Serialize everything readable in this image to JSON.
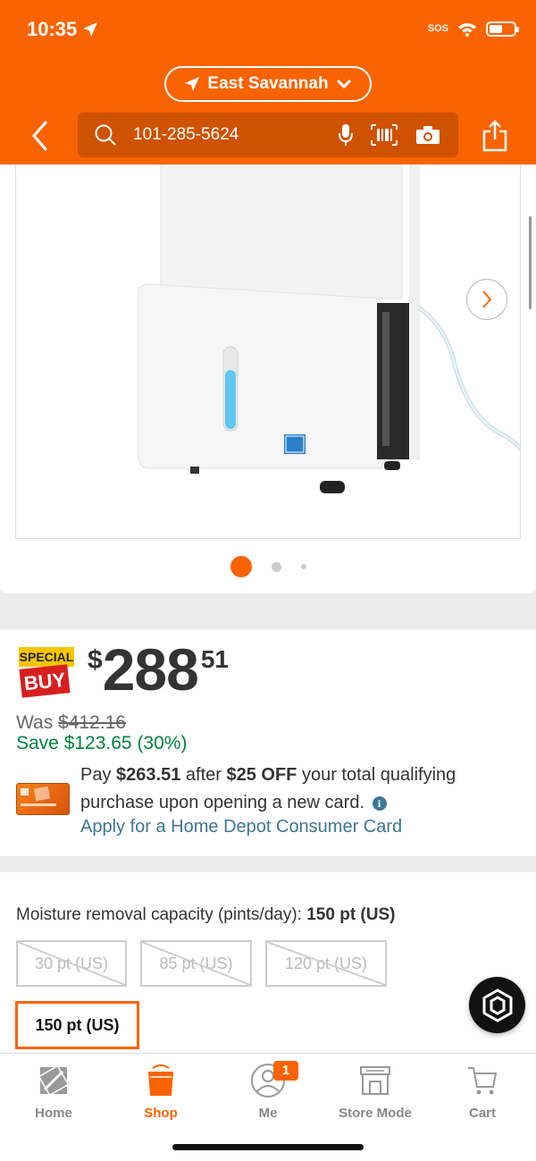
{
  "status_bar": {
    "time": "10:35",
    "sos": "SOS"
  },
  "header": {
    "location": "East Savannah",
    "search_value": "101-285-5624",
    "brand_color": "#f96302"
  },
  "gallery": {
    "total_images": 3,
    "active_index": 0
  },
  "pricing": {
    "badge_line1": "SPECIAL",
    "badge_line2": "BUY",
    "price_dollar": "$",
    "price_main": "288",
    "price_cents": "51",
    "was_label": "Was",
    "was_amount": "$412.16",
    "save_text": "Save $123.65 (30%)",
    "pay_prefix": "Pay ",
    "pay_amount": "$263.51",
    "pay_mid": " after ",
    "pay_off": "$25 OFF",
    "pay_suffix": " your total qualifying purchase upon opening a new card.",
    "apply_link": "Apply for a Home Depot Consumer Card"
  },
  "options": {
    "label": "Moisture removal capacity (pints/day): ",
    "selected_value": "150 pt (US)",
    "choices": [
      {
        "label": "30 pt (US)",
        "available": false
      },
      {
        "label": "85 pt (US)",
        "available": false
      },
      {
        "label": "120 pt (US)",
        "available": false
      },
      {
        "label": "150 pt (US)",
        "available": true,
        "selected": true
      }
    ]
  },
  "tabbar": {
    "tabs": [
      {
        "label": "Home"
      },
      {
        "label": "Shop",
        "active": true
      },
      {
        "label": "Me",
        "badge": "1"
      },
      {
        "label": "Store Mode"
      },
      {
        "label": "Cart"
      }
    ]
  }
}
